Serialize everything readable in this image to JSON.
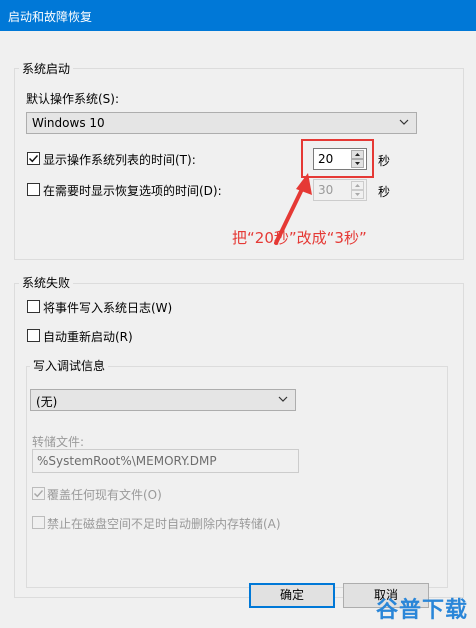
{
  "window": {
    "title": "启动和故障恢复"
  },
  "system_startup": {
    "group_label": "系统启动",
    "default_os_label": "默认操作系统(S):",
    "default_os_value": "Windows 10",
    "show_list_label": "显示操作系统列表的时间(T):",
    "show_list_checked": true,
    "show_list_value": "20",
    "show_list_unit": "秒",
    "show_recovery_label": "在需要时显示恢复选项的时间(D):",
    "show_recovery_checked": false,
    "show_recovery_value": "30",
    "show_recovery_unit": "秒"
  },
  "annotation": {
    "text": "把“20秒”改成“3秒”",
    "color": "#e53935"
  },
  "system_failure": {
    "group_label": "系统失败",
    "write_event_label": "将事件写入系统日志(W)",
    "write_event_checked": false,
    "auto_restart_label": "自动重新启动(R)",
    "auto_restart_checked": false,
    "debug_group_label": "写入调试信息",
    "debug_select_value": "(无)",
    "dump_file_label": "转储文件:",
    "dump_file_value": "%SystemRoot%\\MEMORY.DMP",
    "overwrite_label": "覆盖任何现有文件(O)",
    "overwrite_checked": true,
    "disable_autodelete_label": "禁止在磁盘空间不足时自动删除内存转储(A)",
    "disable_autodelete_checked": false
  },
  "buttons": {
    "ok": "确定",
    "cancel": "取消"
  },
  "watermark": "谷普下载",
  "colors": {
    "titlebar": "#0078d7",
    "accent": "#0078d7",
    "annotation": "#e53935"
  }
}
